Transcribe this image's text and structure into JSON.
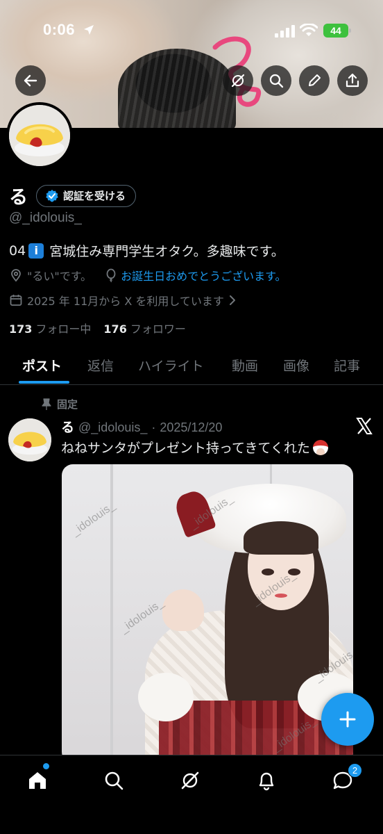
{
  "status_bar": {
    "time": "0:06",
    "battery": "44"
  },
  "profile": {
    "name": "る",
    "verify_label": "認証を受ける",
    "handle": "@_idolouis_",
    "bio_prefix": "04",
    "bio_emoji_char": "i",
    "bio_text": "宮城住み専門学生オタク。多趣味です。",
    "location": "\"るい\"です。",
    "birthday_text": "お誕生日おめでとうございます。",
    "joined": "2025 年 11月から X を利用しています",
    "following_count": "173",
    "following_label": "フォロー中",
    "followers_count": "176",
    "followers_label": "フォロワー"
  },
  "tabs": [
    {
      "label": "ポスト",
      "active": true
    },
    {
      "label": "返信"
    },
    {
      "label": "ハイライト"
    },
    {
      "label": "動画"
    },
    {
      "label": "画像"
    },
    {
      "label": "記事"
    }
  ],
  "post": {
    "pinned_label": "固定",
    "author": "る",
    "handle": "@_idolouis_",
    "separator": "·",
    "date": "2025/12/20",
    "text": "ねねサンタがプレゼント持ってきてくれた",
    "watermark": "_idolouis_"
  },
  "nav": {
    "messages_badge": "2"
  },
  "icons": {
    "back": "back-arrow-icon",
    "grok": "grok-icon",
    "search": "search-icon",
    "edit": "pencil-icon",
    "share": "share-icon",
    "location": "location-icon",
    "balloon": "balloon-icon",
    "calendar": "calendar-icon",
    "pin": "pin-icon",
    "x_logo": "x-logo-icon",
    "compose": "plus-icon",
    "home": "home-icon",
    "notifications": "bell-icon",
    "messages": "messages-icon"
  },
  "colors": {
    "accent": "#1d9bf0",
    "background": "#000000",
    "muted_text": "#71767b",
    "border": "#2f3336"
  }
}
